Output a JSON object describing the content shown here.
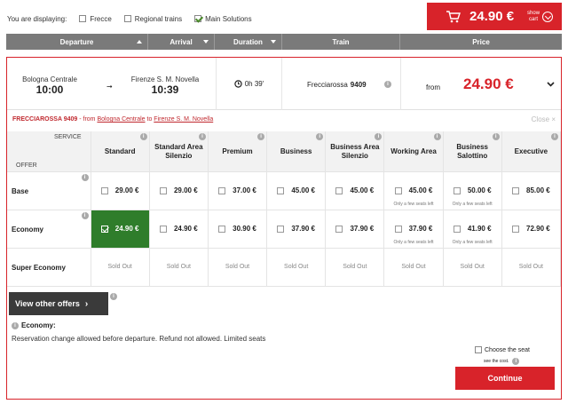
{
  "filters": {
    "label": "You are displaying:",
    "items": [
      {
        "label": "Frecce",
        "checked": false
      },
      {
        "label": "Regional trains",
        "checked": false
      },
      {
        "label": "Main Solutions",
        "checked": true
      }
    ]
  },
  "cart": {
    "price": "24.90 €",
    "show_line1": "show",
    "show_line2": "cart"
  },
  "columns": [
    {
      "label": "Departure",
      "sort": "up"
    },
    {
      "label": "Arrival",
      "sort": "down"
    },
    {
      "label": "Duration",
      "sort": "down"
    },
    {
      "label": "Train",
      "sort": ""
    },
    {
      "label": "Price",
      "sort": ""
    }
  ],
  "solution": {
    "departure_station": "Bologna Centrale",
    "departure_time": "10:00",
    "arrival_station": "Firenze S. M. Novella",
    "arrival_time": "10:39",
    "duration": "0h 39'",
    "train": "Frecciarossa",
    "train_number": "9409",
    "price_prefix": "from",
    "price": "24.90 €"
  },
  "detail": {
    "train": "FRECCIAROSSA 9409",
    "from_label": "- from",
    "from_station": "Bologna Centrale",
    "to_label": "to",
    "to_station": "Firenze S. M. Novella",
    "close": "Close ×"
  },
  "grid": {
    "service_label": "SERVICE",
    "offer_label": "OFFER",
    "services": [
      "Standard",
      "Standard Area Silenzio",
      "Premium",
      "Business",
      "Business Area Silenzio",
      "Working Area",
      "Business Salottino",
      "Executive"
    ],
    "offers": [
      {
        "name": "Base",
        "prices": [
          {
            "value": "29.00 €"
          },
          {
            "value": "29.00 €"
          },
          {
            "value": "37.00 €"
          },
          {
            "value": "45.00 €"
          },
          {
            "value": "45.00 €"
          },
          {
            "value": "45.00 €",
            "note": "Only a few seats left"
          },
          {
            "value": "50.00 €",
            "note": "Only a few seats left"
          },
          {
            "value": "85.00 €"
          }
        ]
      },
      {
        "name": "Economy",
        "prices": [
          {
            "value": "24.90 €",
            "selected": true
          },
          {
            "value": "24.90 €"
          },
          {
            "value": "30.90 €"
          },
          {
            "value": "37.90 €"
          },
          {
            "value": "37.90 €"
          },
          {
            "value": "37.90 €",
            "note": "Only a few seats left"
          },
          {
            "value": "41.90 €",
            "note": "Only a few seats left"
          },
          {
            "value": "72.90 €"
          }
        ]
      },
      {
        "name": "Super Economy",
        "prices": [
          {
            "sold": "Sold Out"
          },
          {
            "sold": "Sold Out"
          },
          {
            "sold": "Sold Out"
          },
          {
            "sold": "Sold Out"
          },
          {
            "sold": "Sold Out"
          },
          {
            "sold": "Sold Out"
          },
          {
            "sold": "Sold Out"
          },
          {
            "sold": "Sold Out"
          }
        ]
      }
    ]
  },
  "view_offers": "View other offers",
  "economy": {
    "title": "Economy:",
    "description": "Reservation change allowed before departure. Refund not allowed. Limited seats"
  },
  "seat": {
    "label": "Choose the seat",
    "cost": "see the cost."
  },
  "continue_label": "Continue",
  "colors": {
    "brand_red": "#d8232a",
    "selected_green": "#2f7d2b",
    "header_gray": "#7a7a7a"
  }
}
